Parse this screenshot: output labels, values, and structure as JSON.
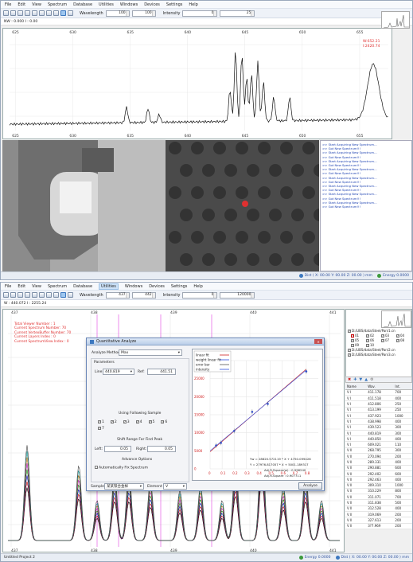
{
  "menu": [
    "File",
    "Edit",
    "View",
    "Spectrum",
    "Database",
    "Utilities",
    "Windows",
    "Devices",
    "Settings",
    "Help"
  ],
  "toolbar1": {
    "wavelength_label": "Wavelength",
    "wl_from": "100",
    "wl_to": "100",
    "intensity_label": "Intensity",
    "int_from": "0",
    "int_to": "25"
  },
  "coords1": {
    "text": "NW : 0.000   I : 0.00"
  },
  "chart1": {
    "x_ticks": [
      "625",
      "630",
      "635",
      "640",
      "645",
      "650",
      "655"
    ],
    "cursor_readout": [
      "W:652.21",
      "I:2420.74"
    ]
  },
  "log1": {
    "lines": [
      ">> Start Acquiring New Spectrum...",
      ">> Got New Spectrum!!!",
      ">> Start Acquiring New Spectrum...",
      ">> Got New Spectrum!!!",
      ">> Start Acquiring New Spectrum...",
      ">> Got New Spectrum!!!",
      ">> Start Acquiring New Spectrum...",
      ">> Got New Spectrum!!!",
      ">> Start Acquiring New Spectrum...",
      ">> Got New Spectrum!!!",
      ">> Start Acquiring New Spectrum...",
      ">> Got New Spectrum!!!",
      ">> Start Acquiring New Spectrum...",
      ">> Got New Spectrum!!!",
      ">> Start Acquiring New Spectrum...",
      ">> Got New Spectrum!!!"
    ]
  },
  "status1": {
    "dist": "Dist ( X: 00.00 Y: 00.00 Z: 00.00 ) mm",
    "energy": "Energy 0.0000"
  },
  "toolbar2": {
    "wavelength_label": "Wavelength",
    "wl_from": "437",
    "wl_to": "442",
    "intensity_label": "Intensity",
    "int_from": "0",
    "int_to": "120000"
  },
  "coords2": {
    "text": "W : 440.072   I : 2255.24"
  },
  "chart2": {
    "x_ticks": [
      "437",
      "438",
      "439",
      "440",
      "441"
    ],
    "info_lines": [
      "Total Viewer Number : 1",
      "Current Spectrum Number: 70",
      "Current VertexBuffer Number: 70",
      "Current Layers Index : 0",
      "Current SpectrumView Index : 0"
    ]
  },
  "rpanel_files": [
    {
      "path": "D:/LIBS/data/Steel/Pan/1.cn"
    },
    {
      "path": "D:/LIBS/data/Steel/Pan/2.cn"
    },
    {
      "path": "D:/LIBS/data/Steel/Pan/3.cn"
    }
  ],
  "rpanel_checks": [
    "01",
    "02",
    "03",
    "04",
    "05",
    "06",
    "07",
    "08",
    "09",
    "10"
  ],
  "table": {
    "headers": [
      "Name",
      "Wav.",
      "Int."
    ],
    "rows": [
      [
        "V I",
        "411.178",
        "700"
      ],
      [
        "V I",
        "411.518",
        "400"
      ],
      [
        "V I",
        "412.806",
        "250"
      ],
      [
        "V I",
        "413.199",
        "250"
      ],
      [
        "V I",
        "437.923",
        "1000"
      ],
      [
        "V I",
        "438.998",
        "400"
      ],
      [
        "V I",
        "439.523",
        "300"
      ],
      [
        "V I",
        "440.819",
        "300"
      ],
      [
        "V I",
        "440.850",
        "400"
      ],
      [
        "V I",
        "609.021",
        "110"
      ],
      [
        "V II",
        "268.795",
        "300"
      ],
      [
        "V II",
        "270.094",
        "200"
      ],
      [
        "V II",
        "289.331",
        "400"
      ],
      [
        "V II",
        "290.881",
        "600"
      ],
      [
        "V II",
        "292.402",
        "600"
      ],
      [
        "V II",
        "292.463",
        "400"
      ],
      [
        "V II",
        "309.310",
        "1000"
      ],
      [
        "V II",
        "310.229",
        "800"
      ],
      [
        "V II",
        "311.071",
        "700"
      ],
      [
        "V II",
        "311.838",
        "500"
      ],
      [
        "V II",
        "312.528",
        "400"
      ],
      [
        "V II",
        "319.069",
        "200"
      ],
      [
        "V II",
        "327.613",
        "200"
      ],
      [
        "V II",
        "3?7.969",
        "200"
      ]
    ]
  },
  "status2": {
    "project": "Untitled Project 2",
    "energy": "Energy 0.0000",
    "dist": "Dist ( X: 00.00 Y: 00.00 Z: 00.00 ) mm"
  },
  "dialog": {
    "title": "Quantitative Analyze",
    "method_label": "Analyze Method",
    "method": "Max",
    "parameters": "Parameters",
    "line_label": "Line:",
    "line": "440.819",
    "ref_label": "Ref:",
    "ref": "441.51",
    "using_samples": "Using Following Sample",
    "samples": [
      "1",
      "2",
      "3",
      "4",
      "5",
      "6",
      "7"
    ],
    "shift_range": "Shift Range For Find Peak",
    "left_label": "Left:",
    "left": "0.05",
    "right_label": "Right:",
    "right": "0.05",
    "advance": "Advance Options",
    "auto_fix": "Automatically Fix Spectrum",
    "sample_label": "Sample",
    "sample": "某某铁合金样",
    "element_label": "Element",
    "element": "V",
    "analyse_btn": "Analyse",
    "legend": [
      "linear fit",
      "weight linear fit",
      "error bar",
      "intensity"
    ],
    "eq1": "Yw = 28620.572119 * X + 4750.099426",
    "eq2": "Y = 27976.817057 * X + 5001.189317",
    "adjr1": "Adj.R-Square(w) : 0.996240",
    "adjr2": "Adj.R-Square : 0.907711",
    "y_ticks": [
      "0",
      "5000",
      "10000",
      "15000",
      "20000",
      "25000",
      "30000"
    ],
    "x_ticks": [
      "0",
      "0.1",
      "0.2",
      "0.3",
      "0.4",
      "0.5",
      "0.6",
      "0.7",
      "0.8"
    ]
  },
  "chart_data": {
    "type": "scatter",
    "series": [
      {
        "name": "intensity",
        "x": [
          0.05,
          0.09,
          0.2,
          0.35,
          0.48,
          0.8
        ],
        "y": [
          6500,
          7200,
          10500,
          15800,
          18000,
          27000
        ]
      }
    ],
    "xlim": [
      0,
      0.9
    ],
    "ylim": [
      0,
      30000
    ]
  },
  "colors": {
    "accent": "#3c78c0",
    "red": "#e03030",
    "blue": "#2a4ee0"
  }
}
